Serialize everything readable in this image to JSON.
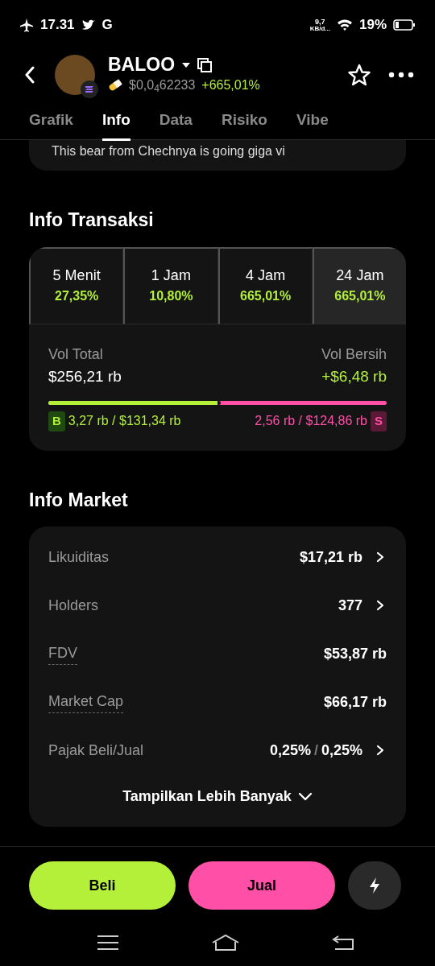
{
  "status_bar": {
    "time": "17.31",
    "carrier_letter": "G",
    "net_speed_value": "9,7",
    "net_speed_unit": "KB/d...",
    "battery": "19%"
  },
  "header": {
    "name": "BALOO",
    "price": "$0,0$_{4}$62233",
    "change": "+665,01%"
  },
  "tabs": [
    {
      "label": "Grafik",
      "selected": false
    },
    {
      "label": "Info",
      "selected": true
    },
    {
      "label": "Data",
      "selected": false
    },
    {
      "label": "Risiko",
      "selected": false
    },
    {
      "label": "Vibe",
      "selected": false
    }
  ],
  "description": "This bear from Chechnya is going giga vi",
  "transactions": {
    "title": "Info Transaksi",
    "periods": [
      {
        "label": "5 Menit",
        "change": "27,35%",
        "selected": false
      },
      {
        "label": "1 Jam",
        "change": "10,80%",
        "selected": false
      },
      {
        "label": "4 Jam",
        "change": "665,01%",
        "selected": false
      },
      {
        "label": "24 Jam",
        "change": "665,01%",
        "selected": true
      }
    ],
    "vol_total_label": "Vol Total",
    "vol_total": "$256,21 rb",
    "vol_net_label": "Vol Bersih",
    "vol_net": "+$6,48 rb",
    "buy": {
      "badge": "B",
      "count": "3,27 rb",
      "amount": "$131,34 rb",
      "level": 0.51
    },
    "sell": {
      "badge": "S",
      "count": "2,56 rb",
      "amount": "$124,86 rb"
    },
    "separator": "/"
  },
  "market": {
    "title": "Info Market",
    "rows": [
      {
        "label": "Likuiditas",
        "values": [
          "$17,21 rb"
        ],
        "chevron": true,
        "dotted": false
      },
      {
        "label": "Holders",
        "values": [
          "377"
        ],
        "chevron": true,
        "dotted": false
      },
      {
        "label": "FDV",
        "values": [
          "$53,87 rb"
        ],
        "chevron": false,
        "dotted": true
      },
      {
        "label": "Market Cap",
        "values": [
          "$66,17 rb"
        ],
        "chevron": false,
        "dotted": true
      },
      {
        "label": "Pajak Beli/Jual",
        "values": [
          "0,25%",
          "0,25%"
        ],
        "separator": "/",
        "chevron": true,
        "dotted": false
      }
    ],
    "more": "Tampilkan Lebih Banyak"
  },
  "actions": {
    "buy": "Beli",
    "sell": "Jual"
  }
}
